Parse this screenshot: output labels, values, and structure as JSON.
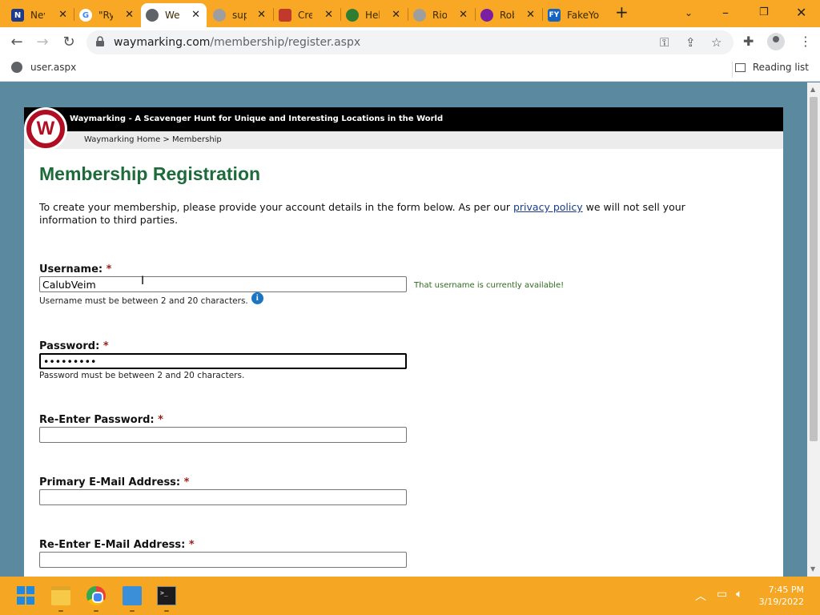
{
  "browser": {
    "tabs": [
      {
        "title": "Nev",
        "favicon": "N",
        "color": "#1e3a8a"
      },
      {
        "title": "\"Ry",
        "favicon": "G",
        "color": "#4285f4"
      },
      {
        "title": "We",
        "favicon": "globe",
        "color": "#5f6368",
        "active": true
      },
      {
        "title": "sup",
        "favicon": "globe",
        "color": "#8a8a8a"
      },
      {
        "title": "Cre",
        "favicon": "cube",
        "color": "#c0392b"
      },
      {
        "title": "Hel",
        "favicon": "leaf",
        "color": "#2e7d32"
      },
      {
        "title": "Rio",
        "favicon": "globe",
        "color": "#8a8a8a"
      },
      {
        "title": "Rob",
        "favicon": "mask",
        "color": "#7b1fa2"
      },
      {
        "title": "FakeYou",
        "favicon": "FY",
        "color": "#1565c0"
      }
    ],
    "url_host": "waymarking.com",
    "url_path": "/membership/register.aspx",
    "bookmark": "user.aspx",
    "reading_list": "Reading list"
  },
  "site": {
    "tagline": "Waymarking - A Scavenger Hunt for Unique and Interesting Locations in the World",
    "breadcrumb": "Waymarking Home > Membership",
    "logo_letter": "W"
  },
  "page": {
    "title": "Membership Registration",
    "intro_before": "To create your membership, please provide your account details in the form below. As per our ",
    "intro_link": "privacy policy",
    "intro_after": " we will not sell your information to third parties."
  },
  "form": {
    "required_mark": "*",
    "username": {
      "label": "Username:",
      "value": "CalubVeim",
      "hint": "Username must be between 2 and 20 characters.",
      "status": "That username is currently available!"
    },
    "password": {
      "label": "Password:",
      "value": "•••••••••",
      "hint": "Password must be between 2 and 20 characters."
    },
    "reenter_password": {
      "label": "Re-Enter Password:",
      "value": ""
    },
    "primary_email": {
      "label": "Primary E-Mail Address:",
      "value": ""
    },
    "reenter_email": {
      "label": "Re-Enter E-Mail Address:",
      "value": ""
    }
  },
  "taskbar": {
    "time": "7:45 PM",
    "date": "3/19/2022"
  }
}
